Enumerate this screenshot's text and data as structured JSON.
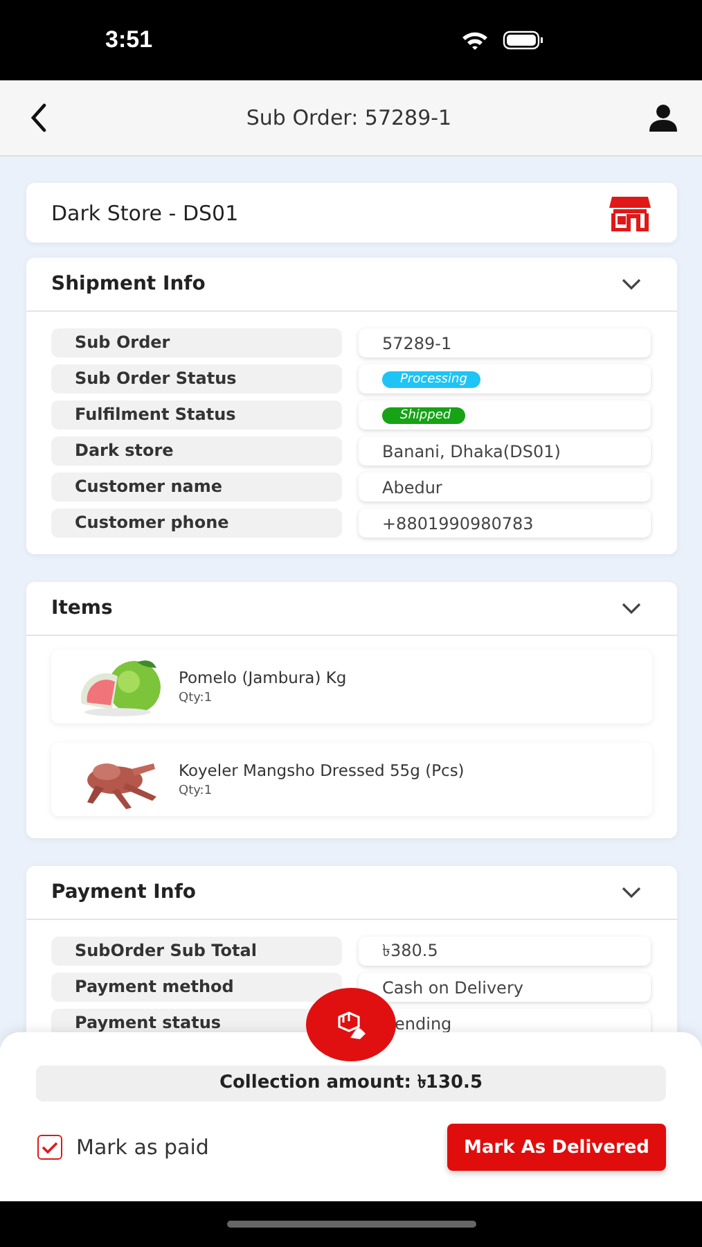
{
  "status_bar": {
    "time": "3:51"
  },
  "header": {
    "title": "Sub Order: 57289-1"
  },
  "store": {
    "name": "Dark Store - DS01"
  },
  "shipment_info": {
    "title": "Shipment Info",
    "rows": [
      {
        "label": "Sub Order",
        "value": "57289-1",
        "kind": "text"
      },
      {
        "label": "Sub Order Status",
        "value": "Processing",
        "kind": "badge",
        "color": "#1ec4f4"
      },
      {
        "label": "Fulfilment Status",
        "value": "Shipped",
        "kind": "badge",
        "color": "#16a316"
      },
      {
        "label": "Dark store",
        "value": "Banani, Dhaka(DS01)",
        "kind": "text"
      },
      {
        "label": "Customer name",
        "value": "Abedur",
        "kind": "text"
      },
      {
        "label": "Customer phone",
        "value": "+8801990980783",
        "kind": "text"
      }
    ]
  },
  "items": {
    "title": "Items",
    "list": [
      {
        "name": "Pomelo (Jambura) Kg",
        "qty": "Qty:1",
        "kind": "picture"
      },
      {
        "name": "Koyeler Mangsho Dressed 55g (Pcs)",
        "qty": "Qty:1",
        "kind": "picture"
      }
    ]
  },
  "payment_info": {
    "title": "Payment Info",
    "rows": [
      {
        "label": "SubOrder Sub Total",
        "value": "৳380.5",
        "kind": "text"
      },
      {
        "label": "Payment method",
        "value": "Cash on Delivery",
        "kind": "text"
      },
      {
        "label": "Payment status",
        "value": "ending",
        "kind": "text"
      }
    ]
  },
  "bottom_sheet": {
    "collection": "Collection amount: ৳130.5",
    "mark_paid": {
      "label": "Mark as paid",
      "checked": true
    },
    "button": "Mark As Delivered"
  }
}
